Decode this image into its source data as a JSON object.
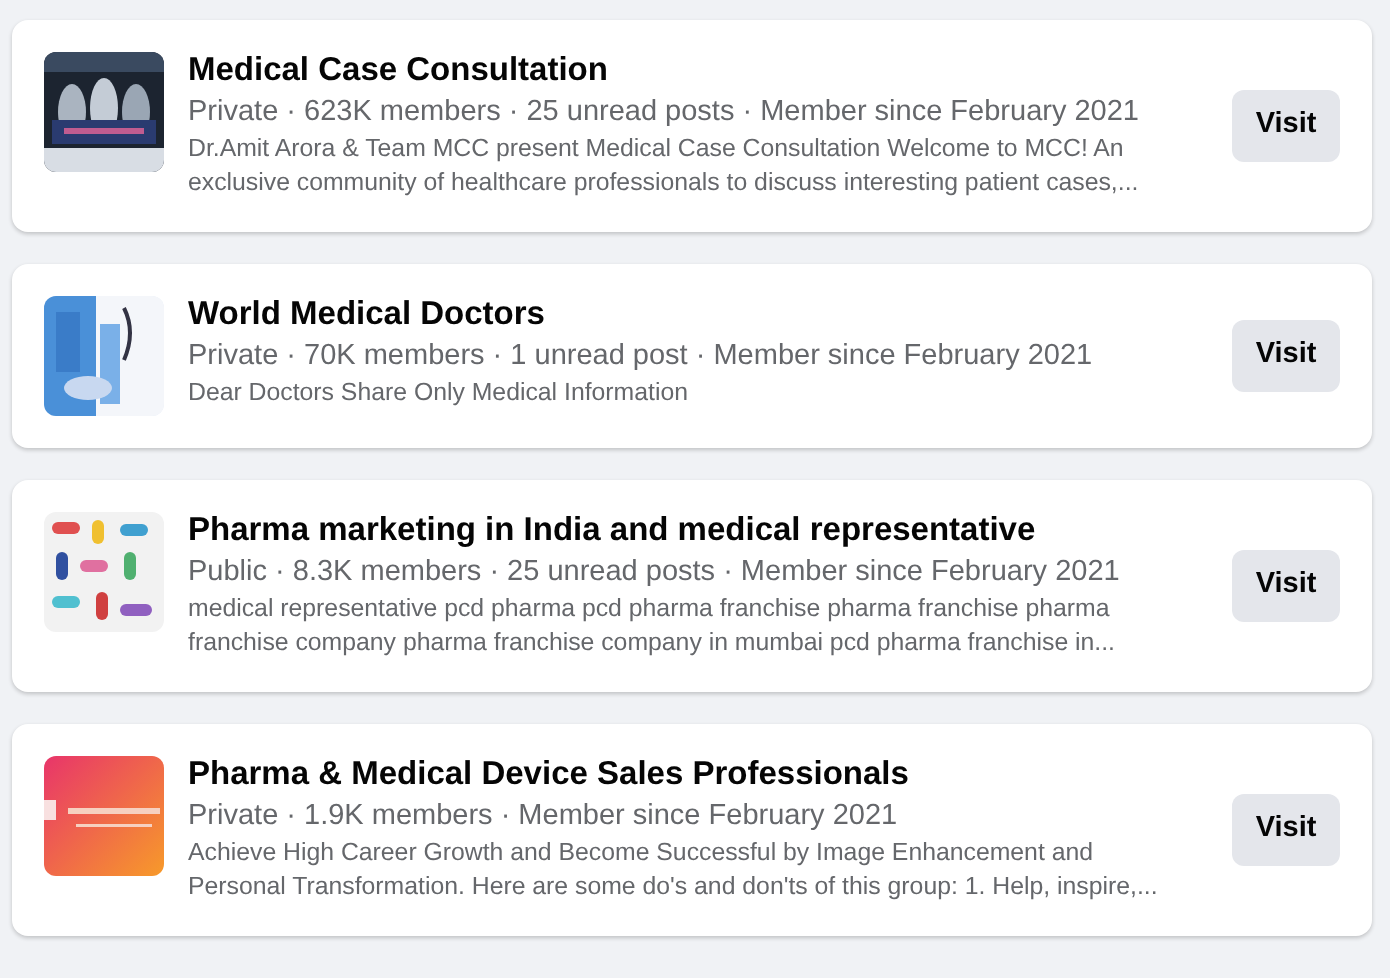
{
  "groups": [
    {
      "name": "Medical Case Consultation",
      "meta": "Private · 623K members · 25 unread posts · Member since February 2021",
      "description": "Dr.Amit Arora & Team MCC present Medical Case Consultation Welcome to MCC! An exclusive community of healthcare professionals to discuss interesting patient cases,...",
      "button": "Visit"
    },
    {
      "name": "World Medical Doctors",
      "meta": "Private · 70K members · 1 unread post · Member since February 2021",
      "description": "Dear Doctors Share Only Medical Information",
      "button": "Visit"
    },
    {
      "name": "Pharma marketing in India and medical representative",
      "meta": "Public · 8.3K members · 25 unread posts · Member since February 2021",
      "description": "medical representative pcd pharma pcd pharma franchise pharma franchise pharma franchise company pharma franchise company in mumbai pcd pharma franchise in...",
      "button": "Visit"
    },
    {
      "name": "Pharma & Medical Device Sales Professionals",
      "meta": "Private · 1.9K members · Member since February 2021",
      "description": "Achieve High Career Growth and Become Successful by Image Enhancement and Personal Transformation. Here are some do's and don'ts of this group: 1. Help, inspire,...",
      "button": "Visit"
    }
  ]
}
